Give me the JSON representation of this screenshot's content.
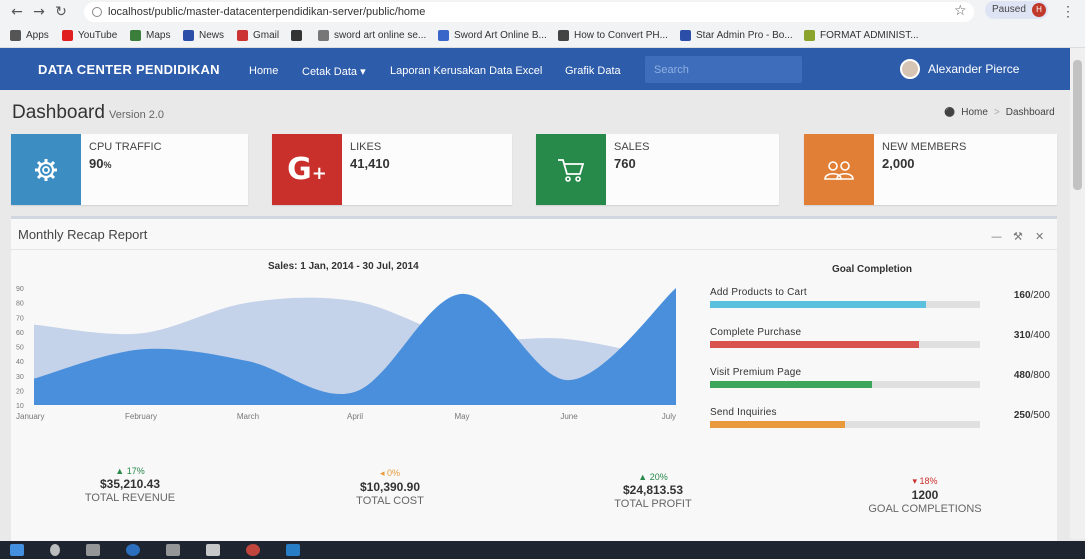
{
  "browser": {
    "url": "localhost/public/master-datacenterpendidikan-server/public/home",
    "paused_label": "Paused",
    "profile_initial": "H",
    "bookmarks": [
      {
        "label": "Apps",
        "color": "#555555"
      },
      {
        "label": "YouTube",
        "color": "#e02020"
      },
      {
        "label": "Maps",
        "color": "#3b7d3b"
      },
      {
        "label": "News",
        "color": "#2b4fa8"
      },
      {
        "label": "Gmail",
        "color": "#c33"
      },
      {
        "label": "",
        "color": "#333333"
      },
      {
        "label": "sword art online se...",
        "color": "#777777"
      },
      {
        "label": "Sword Art Online B...",
        "color": "#3a66c9"
      },
      {
        "label": "How to Convert PH...",
        "color": "#444444"
      },
      {
        "label": "Star Admin Pro - Bo...",
        "color": "#2b4fa8"
      },
      {
        "label": "FORMAT ADMINIST...",
        "color": "#8aa32a"
      }
    ]
  },
  "navbar": {
    "brand": "DATA CENTER PENDIDIKAN",
    "links": [
      "Home",
      "Cetak Data ▾",
      "Laporan Kerusakan Data Excel",
      "Grafik Data"
    ],
    "search_placeholder": "Search",
    "user_name": "Alexander Pierce",
    "bg_color": "#2d5cab"
  },
  "header": {
    "title": "Dashboard",
    "subtitle": "Version 2.0",
    "breadcrumb": [
      "Home",
      "Dashboard"
    ]
  },
  "info_boxes": [
    {
      "label": "CPU TRAFFIC",
      "value": "90",
      "unit": "%",
      "color": "#3c8dc1",
      "icon": "gear-icon"
    },
    {
      "label": "LIKES",
      "value": "41,410",
      "unit": "",
      "color": "#c9302c",
      "icon": "google-plus-icon"
    },
    {
      "label": "SALES",
      "value": "760",
      "unit": "",
      "color": "#27894a",
      "icon": "cart-icon"
    },
    {
      "label": "NEW MEMBERS",
      "value": "2,000",
      "unit": "",
      "color": "#e07f35",
      "icon": "users-icon"
    }
  ],
  "report": {
    "title": "Monthly Recap Report",
    "chart_title": "Sales: 1 Jan, 2014 - 30 Jul, 2014",
    "goal_title": "Goal Completion",
    "goals": [
      {
        "label": "Add Products to Cart",
        "current": "160",
        "total": "/200",
        "fraction": 0.8,
        "color": "#5bc0de"
      },
      {
        "label": "Complete Purchase",
        "current": "310",
        "total": "/400",
        "fraction": 0.775,
        "color": "#d9534f"
      },
      {
        "label": "Visit Premium Page",
        "current": "480",
        "total": "/800",
        "fraction": 0.6,
        "color": "#3aa55b"
      },
      {
        "label": "Send Inquiries",
        "current": "250",
        "total": "/500",
        "fraction": 0.5,
        "color": "#e89a3c"
      }
    ],
    "stats": [
      {
        "pct": "▲ 17%",
        "amount": "$35,210.43",
        "label": "TOTAL REVENUE",
        "color": "#27894a"
      },
      {
        "pct": "◂ 0%",
        "amount": "$10,390.90",
        "label": "TOTAL COST",
        "color": "#e89a3c"
      },
      {
        "pct": "▲ 20%",
        "amount": "$24,813.53",
        "label": "TOTAL PROFIT",
        "color": "#27894a"
      },
      {
        "pct": "▾ 18%",
        "amount": "1200",
        "label": "GOAL COMPLETIONS",
        "color": "#c9302c"
      }
    ]
  },
  "chart_data": {
    "type": "area",
    "title": "Sales: 1 Jan, 2014 - 30 Jul, 2014",
    "categories": [
      "January",
      "February",
      "March",
      "April",
      "May",
      "June",
      "July"
    ],
    "ylim": [
      10,
      90
    ],
    "yticks": [
      90,
      80,
      70,
      60,
      50,
      40,
      30,
      20,
      10
    ],
    "grid": false,
    "series": [
      {
        "values": [
          65,
          59,
          80,
          81,
          56,
          55,
          40
        ],
        "color": "#c4d2ea"
      },
      {
        "values": [
          28,
          48,
          40,
          19,
          86,
          27,
          90
        ],
        "color": "#4a8fdb"
      }
    ]
  }
}
